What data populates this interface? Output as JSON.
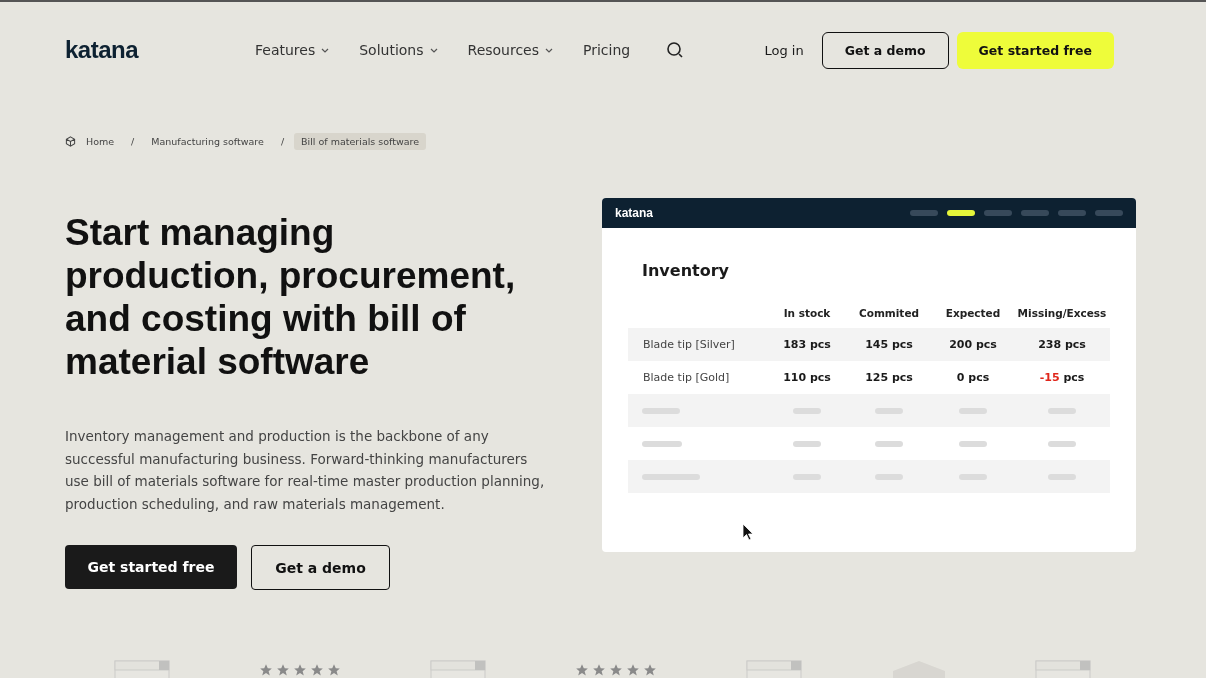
{
  "nav": {
    "logo": "katana",
    "menu": [
      {
        "label": "Features",
        "dropdown": true
      },
      {
        "label": "Solutions",
        "dropdown": true
      },
      {
        "label": "Resources",
        "dropdown": true
      },
      {
        "label": "Pricing",
        "dropdown": false
      }
    ],
    "login": "Log in",
    "demo": "Get a demo",
    "start": "Get started free"
  },
  "breadcrumb_separator": "/",
  "breadcrumb": [
    {
      "label": "Home",
      "current": false
    },
    {
      "label": "Manufacturing software",
      "current": false
    },
    {
      "label": "Bill of materials software",
      "current": true
    }
  ],
  "hero": {
    "title": "Start managing production, procurement, and costing with bill of material software",
    "text": "Inventory management and production is the backbone of any successful manufacturing business. Forward-thinking manufacturers use bill of materials software for real-time master production planning, production scheduling, and raw materials management.",
    "primary": "Get started free",
    "secondary": "Get a demo"
  },
  "app": {
    "logo": "katana",
    "pager": [
      {
        "selected": false
      },
      {
        "selected": true
      },
      {
        "selected": false
      },
      {
        "selected": false
      },
      {
        "selected": false
      },
      {
        "selected": false
      }
    ],
    "title": "Inventory",
    "columns": [
      "In stock",
      "Commited",
      "Expected",
      "Missing/Excess"
    ],
    "rows": [
      {
        "kind": "item",
        "name": "Blade tip [Silver]",
        "cells": [
          {
            "qty": "183",
            "unit": "pcs",
            "alert": false
          },
          {
            "qty": "145",
            "unit": "pcs",
            "alert": false
          },
          {
            "qty": "200",
            "unit": "pcs",
            "alert": false
          },
          {
            "qty": "238",
            "unit": "pcs",
            "alert": false
          }
        ]
      },
      {
        "kind": "item",
        "name": "Blade tip [Gold]",
        "cells": [
          {
            "qty": "110",
            "unit": "pcs",
            "alert": false
          },
          {
            "qty": "125",
            "unit": "pcs",
            "alert": false
          },
          {
            "qty": "0",
            "unit": "pcs",
            "alert": false
          },
          {
            "qty": "-15",
            "unit": "pcs",
            "alert": true
          }
        ]
      },
      {
        "kind": "skeleton"
      },
      {
        "kind": "skeleton"
      },
      {
        "kind": "skeleton"
      }
    ]
  },
  "awards": [
    {
      "kind": "badge"
    },
    {
      "kind": "stars",
      "stars": 5
    },
    {
      "kind": "badge"
    },
    {
      "kind": "stars",
      "stars": 5
    },
    {
      "kind": "badge"
    },
    {
      "kind": "shield"
    },
    {
      "kind": "badge"
    }
  ]
}
